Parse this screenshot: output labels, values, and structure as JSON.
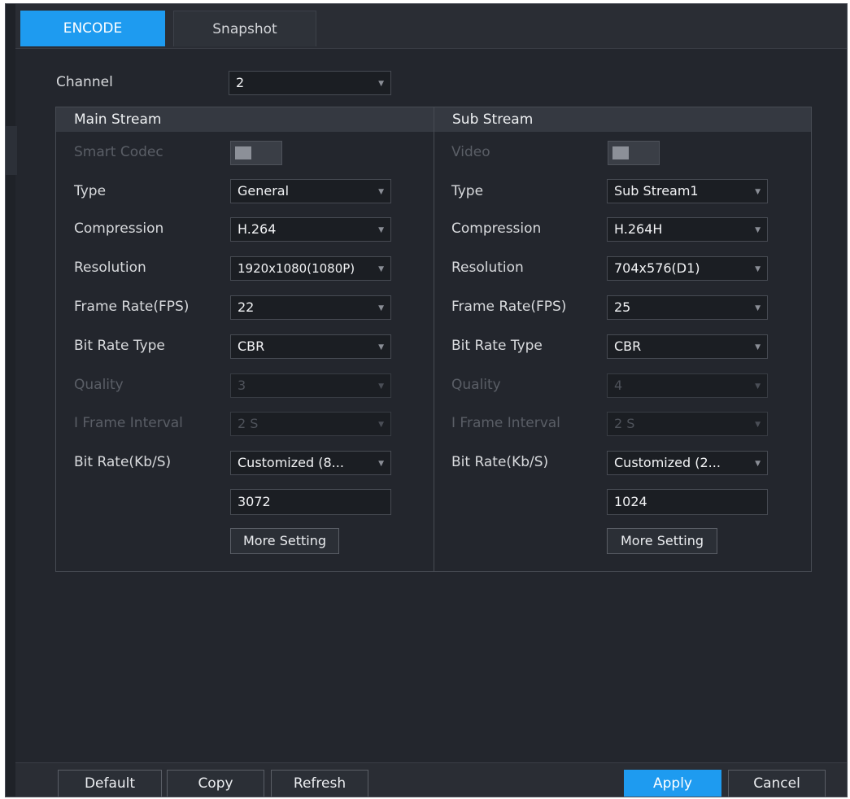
{
  "tabs": [
    {
      "label": "ENCODE",
      "active": true
    },
    {
      "label": "Snapshot",
      "active": false
    }
  ],
  "channel": {
    "label": "Channel",
    "value": "2"
  },
  "main_stream": {
    "header": "Main Stream",
    "smart_codec": {
      "label": "Smart Codec",
      "enabled": false
    },
    "type": {
      "label": "Type",
      "value": "General"
    },
    "compression": {
      "label": "Compression",
      "value": "H.264"
    },
    "resolution": {
      "label": "Resolution",
      "value": "1920x1080(1080P)"
    },
    "frame_rate": {
      "label": "Frame Rate(FPS)",
      "value": "22"
    },
    "bit_rate_type": {
      "label": "Bit Rate Type",
      "value": "CBR"
    },
    "quality": {
      "label": "Quality",
      "value": "3",
      "disabled": true
    },
    "i_frame_interval": {
      "label": "I Frame Interval",
      "value": "2 S",
      "disabled": true
    },
    "bit_rate": {
      "label": "Bit Rate(Kb/S)",
      "value": "Customized (8...",
      "custom_value": "3072"
    },
    "more_setting": "More Setting"
  },
  "sub_stream": {
    "header": "Sub Stream",
    "video": {
      "label": "Video",
      "enabled": false
    },
    "type": {
      "label": "Type",
      "value": "Sub Stream1"
    },
    "compression": {
      "label": "Compression",
      "value": "H.264H"
    },
    "resolution": {
      "label": "Resolution",
      "value": "704x576(D1)"
    },
    "frame_rate": {
      "label": "Frame Rate(FPS)",
      "value": "25"
    },
    "bit_rate_type": {
      "label": "Bit Rate Type",
      "value": "CBR"
    },
    "quality": {
      "label": "Quality",
      "value": "4",
      "disabled": true
    },
    "i_frame_interval": {
      "label": "I Frame Interval",
      "value": "2 S",
      "disabled": true
    },
    "bit_rate": {
      "label": "Bit Rate(Kb/S)",
      "value": "Customized (2...",
      "custom_value": "1024"
    },
    "more_setting": "More Setting"
  },
  "footer": {
    "default": "Default",
    "copy": "Copy",
    "refresh": "Refresh",
    "apply": "Apply",
    "cancel": "Cancel"
  },
  "colors": {
    "accent": "#1e9bf0",
    "background": "#23262d"
  },
  "icons": {
    "dropdown_arrow": "chevron-down-icon"
  }
}
